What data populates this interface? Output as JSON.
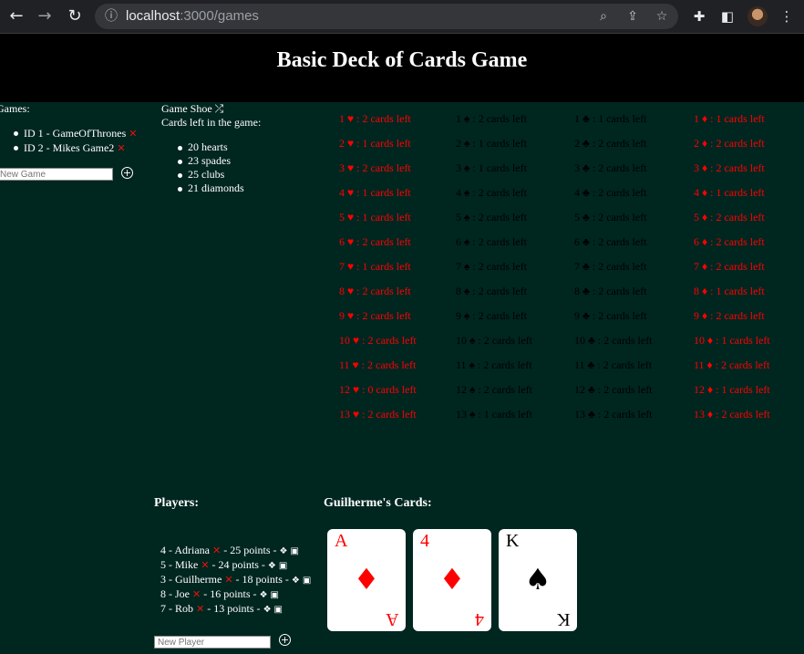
{
  "browser": {
    "url_host": "localhost",
    "url_path": ":3000/games"
  },
  "header": {
    "title": "Basic Deck of Cards Game"
  },
  "games": {
    "title": "Games:",
    "items": [
      {
        "label": "ID 1 - GameOfThrones"
      },
      {
        "label": "ID 2 - Mikes Game2"
      }
    ],
    "input_placeholder": "New Game"
  },
  "shoe": {
    "title": "Game Shoe",
    "subtitle": "Cards left in the game:",
    "counts": [
      "20 hearts",
      "23 spades",
      "25 clubs",
      "21 diamonds"
    ]
  },
  "card_grid": {
    "columns": [
      {
        "suit": "hearts",
        "color": "#ff0000",
        "cells": [
          "1 ♥ : 2 cards left",
          "2 ♥ : 1 cards left",
          "3 ♥ : 2 cards left",
          "4 ♥ : 1 cards left",
          "5 ♥ : 1 cards left",
          "6 ♥ : 2 cards left",
          "7 ♥ : 1 cards left",
          "8 ♥ : 2 cards left",
          "9 ♥ : 2 cards left",
          "10 ♥ : 2 cards left",
          "11 ♥ : 2 cards left",
          "12 ♥ : 0 cards left",
          "13 ♥ : 2 cards left"
        ]
      },
      {
        "suit": "spades",
        "color": "#000000",
        "cells": [
          "1 ♠ : 2 cards left",
          "2 ♠ : 1 cards left",
          "3 ♠ : 1 cards left",
          "4 ♠ : 2 cards left",
          "5 ♠ : 2 cards left",
          "6 ♠ : 2 cards left",
          "7 ♠ : 2 cards left",
          "8 ♠ : 2 cards left",
          "9 ♠ : 2 cards left",
          "10 ♠ : 2 cards left",
          "11 ♠ : 2 cards left",
          "12 ♠ : 2 cards left",
          "13 ♠ : 1 cards left"
        ]
      },
      {
        "suit": "clubs",
        "color": "#000000",
        "cells": [
          "1 ♣ : 1 cards left",
          "2 ♣ : 2 cards left",
          "3 ♣ : 2 cards left",
          "4 ♣ : 2 cards left",
          "5 ♣ : 2 cards left",
          "6 ♣ : 2 cards left",
          "7 ♣ : 2 cards left",
          "8 ♣ : 2 cards left",
          "9 ♣ : 2 cards left",
          "10 ♣ : 2 cards left",
          "11 ♣ : 2 cards left",
          "12 ♣ : 2 cards left",
          "13 ♣ : 2 cards left"
        ]
      },
      {
        "suit": "diamonds",
        "color": "#ff0000",
        "cells": [
          "1 ♦ : 1 cards left",
          "2 ♦ : 2 cards left",
          "3 ♦ : 2 cards left",
          "4 ♦ : 1 cards left",
          "5 ♦ : 2 cards left",
          "6 ♦ : 2 cards left",
          "7 ♦ : 2 cards left",
          "8 ♦ : 1 cards left",
          "9 ♦ : 2 cards left",
          "10 ♦ : 1 cards left",
          "11 ♦ : 2 cards left",
          "12 ♦ : 1 cards left",
          "13 ♦ : 2 cards left"
        ]
      }
    ]
  },
  "players": {
    "title": "Players:",
    "rows": [
      {
        "id_name": "4 - Adriana",
        "points": "- 25 points -"
      },
      {
        "id_name": "5 - Mike",
        "points": "- 24 points -"
      },
      {
        "id_name": "3 - Guilherme",
        "points": "- 18 points -"
      },
      {
        "id_name": "8 - Joe",
        "points": "- 16 points -"
      },
      {
        "id_name": "7 - Rob",
        "points": "- 13 points -"
      }
    ],
    "input_placeholder": "New Player"
  },
  "hand": {
    "title": "Guilherme's Cards:",
    "cards": [
      {
        "rank": "A",
        "suit": "♦",
        "color": "red"
      },
      {
        "rank": "4",
        "suit": "♦",
        "color": "red"
      },
      {
        "rank": "K",
        "suit": "♠",
        "color": "black"
      }
    ]
  },
  "icons": {
    "delete": "✕",
    "add": "+",
    "shuffle": "⤮",
    "deck": "❖",
    "card": "▣"
  }
}
